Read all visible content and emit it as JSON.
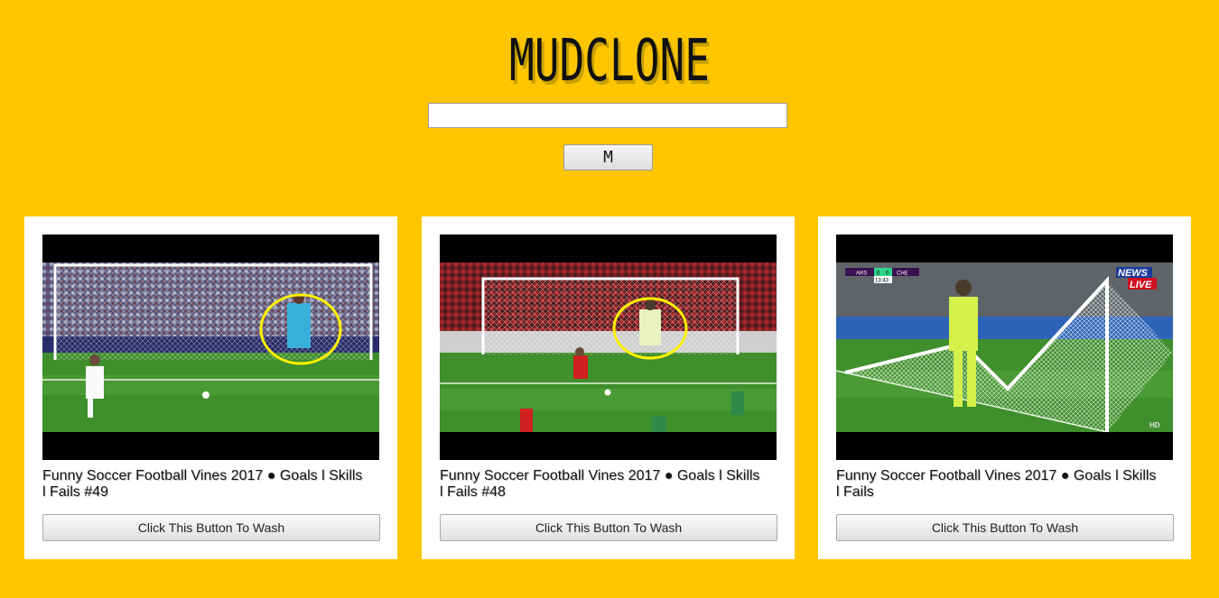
{
  "header": {
    "logo": "MUDCLONE"
  },
  "search": {
    "value": "",
    "button_label": "M"
  },
  "videos": [
    {
      "title": "Funny Soccer Football Vines 2017 ● Goals l Skills l Fails #49",
      "button_label": "Click This Button To Wash"
    },
    {
      "title": "Funny Soccer Football Vines 2017 ● Goals l Skills l Fails #48",
      "button_label": "Click This Button To Wash"
    },
    {
      "title": "Funny Soccer Football Vines 2017 ● Goals l Skills l Fails",
      "button_label": "Click This Button To Wash",
      "scoreboard": {
        "home": "ARS",
        "home_score": "0",
        "away_score": "0",
        "away": "CHE",
        "clock": "13:43"
      },
      "badge_top": "NEWS",
      "badge_bottom": "LIVE",
      "corner_tag": "HD"
    }
  ],
  "colors": {
    "background": "#FFC600",
    "card": "#FFFFFF",
    "pitch": "#3f8f2c",
    "highlight_circle": "#FFF200"
  }
}
